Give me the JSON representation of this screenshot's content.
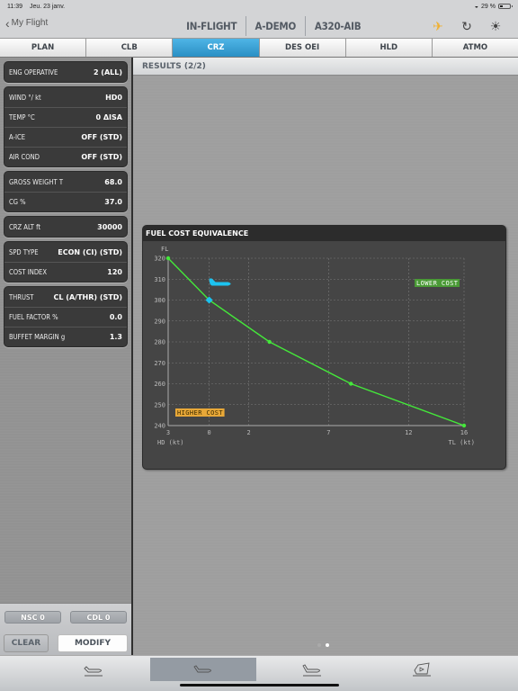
{
  "status_bar": {
    "time": "11:39",
    "date": "Jeu. 23 janv.",
    "wifi_icon": "wifi-icon",
    "battery": "29 %"
  },
  "nav": {
    "back_label": "My Flight",
    "title_segments": [
      "IN-FLIGHT",
      "A-DEMO",
      "A320-AIB"
    ],
    "icons": [
      "airplane-mode-icon",
      "refresh-icon",
      "brightness-icon"
    ],
    "accent_color": "#f0b030"
  },
  "tabs": [
    {
      "label": "PLAN",
      "active": false
    },
    {
      "label": "CLB",
      "active": false
    },
    {
      "label": "CRZ",
      "active": true
    },
    {
      "label": "DES OEI",
      "active": false
    },
    {
      "label": "HLD",
      "active": false
    },
    {
      "label": "ATMO",
      "active": false
    }
  ],
  "params": {
    "groups": [
      [
        {
          "label": "ENG OPERATIVE",
          "value": "2 (ALL)"
        }
      ],
      [
        {
          "label": "WIND °/ kt",
          "value": "HD0"
        },
        {
          "label": "TEMP °C",
          "value": "0 ΔISA"
        },
        {
          "label": "A-ICE",
          "value": "OFF (STD)"
        },
        {
          "label": "AIR COND",
          "value": "OFF (STD)"
        }
      ],
      [
        {
          "label": "GROSS WEIGHT  T",
          "value": "68.0"
        },
        {
          "label": "CG  %",
          "value": "37.0"
        }
      ],
      [
        {
          "label": "CRZ ALT  ft",
          "value": "30000"
        }
      ],
      [
        {
          "label": "SPD TYPE",
          "value": "ECON (CI) (STD)"
        },
        {
          "label": "COST INDEX",
          "value": "120"
        }
      ],
      [
        {
          "label": "THRUST",
          "value": "CL (A/THR) (STD)"
        },
        {
          "label": "FUEL FACTOR  %",
          "value": "0.0"
        },
        {
          "label": "BUFFET MARGIN  g",
          "value": "1.3"
        }
      ]
    ]
  },
  "bottom_buttons": {
    "nsc": "NSC 0",
    "cdl": "CDL 0",
    "clear": "CLEAR",
    "modify": "MODIFY"
  },
  "results": {
    "title": "RESULTS  (2/2)"
  },
  "pager": {
    "pages": 2,
    "current": 2
  },
  "tabbar": {
    "items": [
      {
        "icon": "takeoff-icon",
        "active": false
      },
      {
        "icon": "cruise-icon",
        "active": true
      },
      {
        "icon": "landing-icon",
        "active": false
      },
      {
        "icon": "flight-envelope-icon",
        "active": false
      }
    ]
  },
  "chart_data": {
    "type": "line",
    "title": "FUEL COST EQUIVALENCE",
    "ylabel": "FL",
    "xlabel_left": "HD (kt)",
    "xlabel_right": "TL (kt)",
    "x_ticks": [
      {
        "label": "3",
        "wind_kt": -3
      },
      {
        "label": "0",
        "wind_kt": 0
      },
      {
        "label": "2",
        "wind_kt": 2
      },
      {
        "label": "7",
        "wind_kt": 7
      },
      {
        "label": "12",
        "wind_kt": 12
      },
      {
        "label": "16",
        "wind_kt": 16
      }
    ],
    "y_ticks": [
      240,
      250,
      260,
      270,
      280,
      290,
      300,
      310,
      320
    ],
    "ylim": [
      240,
      320
    ],
    "grid": true,
    "series": [
      {
        "name": "Fuel cost equivalence",
        "color": "#44e83a",
        "points": [
          {
            "wind_kt": -3,
            "fl": 320
          },
          {
            "wind_kt": 0,
            "fl": 300
          },
          {
            "wind_kt": 3.3,
            "fl": 280
          },
          {
            "wind_kt": 8.4,
            "fl": 260
          },
          {
            "wind_kt": 16,
            "fl": 240
          }
        ]
      }
    ],
    "current_point": {
      "wind_kt": 0,
      "fl": 300,
      "color": "#1cc3f0"
    },
    "current_marker_icon": "aircraft-icon",
    "annotations": [
      {
        "text": "LOWER COST",
        "position": "top-right",
        "color": "#4a9a36"
      },
      {
        "text": "HIGHER COST",
        "position": "bottom-left",
        "color": "#e8a838"
      }
    ]
  }
}
